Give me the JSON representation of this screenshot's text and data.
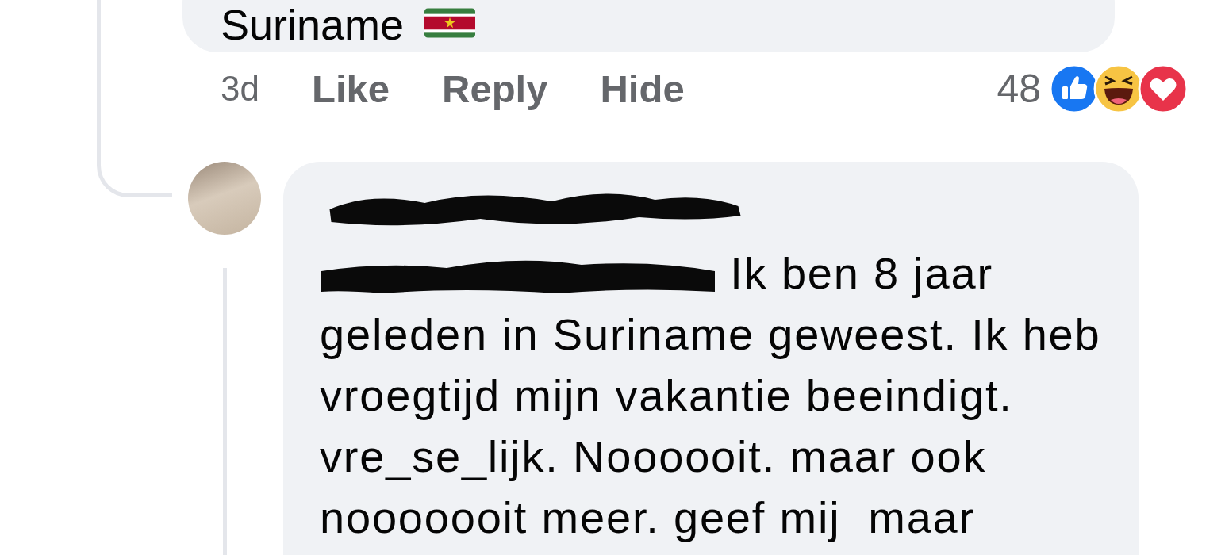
{
  "comment": {
    "text": "Suriname",
    "time": "3d",
    "actions": [
      "Like",
      "Reply",
      "Hide"
    ],
    "reaction_count": "48"
  },
  "reply": {
    "text": "Ik ben 8 jaar geleden in Suriname geweest. Ik heb vroegtijd mijn vakantie beeindigt. vre_se_lijk. Noooooit. maar ook nooooooit meer. geef mij  maar"
  }
}
